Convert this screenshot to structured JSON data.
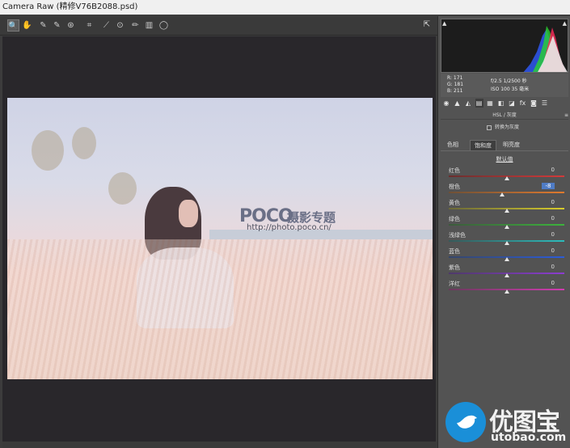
{
  "window": {
    "title": "Camera Raw (精修V76B2088.psd)"
  },
  "toolbar": {
    "tools": [
      {
        "name": "zoom-tool",
        "glyph": "🔍"
      },
      {
        "name": "hand-tool",
        "glyph": "✋"
      },
      {
        "name": "white-balance-tool",
        "glyph": "✎"
      },
      {
        "name": "color-sampler-tool",
        "glyph": "✎"
      },
      {
        "name": "targeted-adjustment-tool",
        "glyph": "⊛"
      },
      {
        "name": "crop-tool",
        "glyph": "⌗"
      },
      {
        "name": "straighten-tool",
        "glyph": "⟋"
      },
      {
        "name": "spot-removal-tool",
        "glyph": "⊙"
      },
      {
        "name": "adjustment-brush-tool",
        "glyph": "✏"
      },
      {
        "name": "graduated-filter-tool",
        "glyph": "▥"
      },
      {
        "name": "radial-filter-tool",
        "glyph": "◯"
      }
    ],
    "fullscreen_glyph": "⇱"
  },
  "preview": {
    "watermark_logo": "POCO",
    "watermark_title": "摄影专题",
    "watermark_url": "http://photo.poco.cn/"
  },
  "histogram": {
    "shadow_clip": "▲",
    "highlight_clip": "▲"
  },
  "info": {
    "r": "R:  171",
    "g": "G:  181",
    "b": "B:  211",
    "aperture_shutter": "f/2.5   1/2500 秒",
    "iso_focal": "ISO 100   35 毫米"
  },
  "panel_tabs": [
    "◉",
    "▲",
    "◭",
    "▤",
    "▦",
    "◧",
    "◪",
    "fx",
    "◙",
    "☰"
  ],
  "section": {
    "title": "HSL / 灰度",
    "menu": "≡"
  },
  "grayscale": {
    "label": "转换为灰度"
  },
  "subtabs": [
    {
      "label": "色相",
      "active": false
    },
    {
      "label": "饱和度",
      "active": true
    },
    {
      "label": "明亮度",
      "active": false
    }
  ],
  "default_label": "默认值",
  "sliders": [
    {
      "label": "红色",
      "value": "0",
      "position": 0.5,
      "editing": false,
      "colors": [
        "#6a2e2e",
        "#d23a3a"
      ]
    },
    {
      "label": "橙色",
      "value": "-8",
      "position": 0.46,
      "editing": true,
      "colors": [
        "#6e5036",
        "#e07a2e"
      ]
    },
    {
      "label": "黄色",
      "value": "0",
      "position": 0.5,
      "editing": false,
      "colors": [
        "#6a6838",
        "#d8cc2c"
      ]
    },
    {
      "label": "绿色",
      "value": "0",
      "position": 0.5,
      "editing": false,
      "colors": [
        "#3c5a3c",
        "#3cb43c"
      ]
    },
    {
      "label": "浅绿色",
      "value": "0",
      "position": 0.5,
      "editing": false,
      "colors": [
        "#365a5a",
        "#2cbcbc"
      ]
    },
    {
      "label": "蓝色",
      "value": "0",
      "position": 0.5,
      "editing": false,
      "colors": [
        "#36466a",
        "#2c5cd8"
      ]
    },
    {
      "label": "紫色",
      "value": "0",
      "position": 0.5,
      "editing": false,
      "colors": [
        "#4e3a6a",
        "#8c3cd0"
      ]
    },
    {
      "label": "洋红",
      "value": "0",
      "position": 0.5,
      "editing": false,
      "colors": [
        "#6a3a5c",
        "#d03cb0"
      ]
    }
  ],
  "badge": {
    "brand": "优图宝",
    "domain": "utobao.com"
  }
}
